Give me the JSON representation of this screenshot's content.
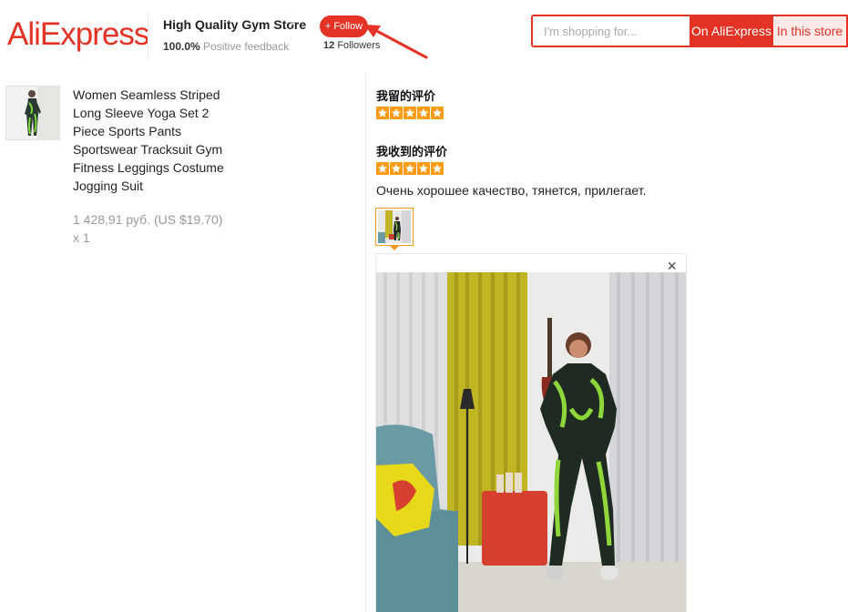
{
  "header": {
    "logo": "AliExpress",
    "store_name": "High Quality Gym Store",
    "feedback_percent": "100.0%",
    "feedback_label": "Positive feedback",
    "follow_label": "+ Follow",
    "followers_count": "12",
    "followers_label": "Followers",
    "search": {
      "placeholder": "I'm shopping for...",
      "value": "",
      "on_aliexpress_label": "On AliExpress",
      "in_store_label": "In this store"
    }
  },
  "product": {
    "title": "Women Seamless Striped Long Sleeve Yoga Set 2 Piece Sports Pants Sportswear Tracksuit Gym Fitness Leggings Costume Jogging Suit",
    "price": "1 428,91 руб. (US $19.70)",
    "quantity": "x 1"
  },
  "reviews": {
    "my_review_label": "我留的评价",
    "my_rating": 5,
    "received_review_label": "我收到的评价",
    "received_rating": 5,
    "received_text": "Очень хорошее качество, тянется, прилегает.",
    "close_symbol": "×"
  },
  "colors": {
    "brand": "#e43225",
    "star": "#ff9b14",
    "thumb_border": "#f39a23"
  }
}
